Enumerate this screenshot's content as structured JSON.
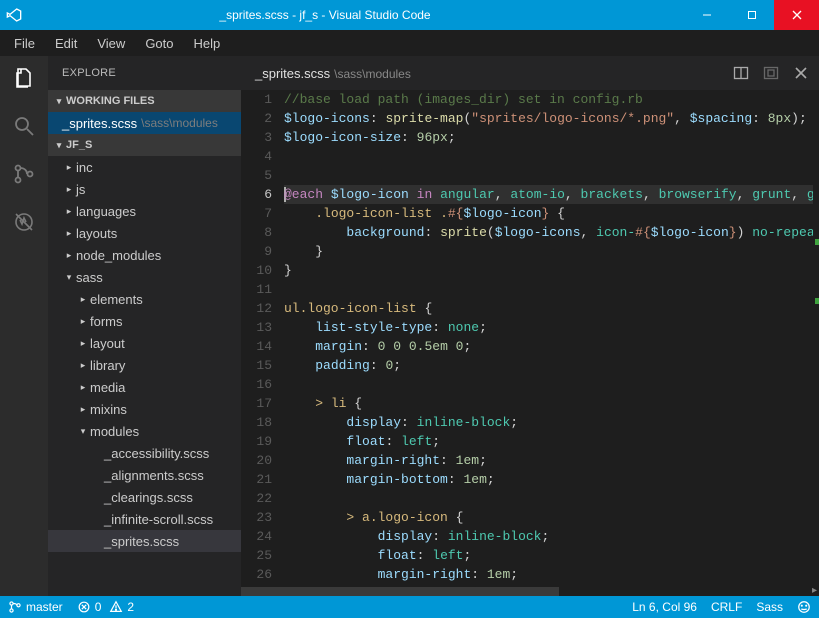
{
  "window": {
    "title": "_sprites.scss - jf_s - Visual Studio Code"
  },
  "menubar": [
    "File",
    "Edit",
    "View",
    "Goto",
    "Help"
  ],
  "sidebar": {
    "title": "EXPLORE",
    "sections": {
      "working": {
        "label": "WORKING FILES",
        "items": [
          {
            "name": "_sprites.scss",
            "path": "\\sass\\modules",
            "selected": true
          }
        ]
      },
      "project": {
        "label": "JF_S",
        "tree": [
          {
            "label": "inc",
            "depth": 1,
            "expandable": true,
            "expanded": false
          },
          {
            "label": "js",
            "depth": 1,
            "expandable": true,
            "expanded": false
          },
          {
            "label": "languages",
            "depth": 1,
            "expandable": true,
            "expanded": false
          },
          {
            "label": "layouts",
            "depth": 1,
            "expandable": true,
            "expanded": false
          },
          {
            "label": "node_modules",
            "depth": 1,
            "expandable": true,
            "expanded": false
          },
          {
            "label": "sass",
            "depth": 1,
            "expandable": true,
            "expanded": true
          },
          {
            "label": "elements",
            "depth": 2,
            "expandable": true,
            "expanded": false
          },
          {
            "label": "forms",
            "depth": 2,
            "expandable": true,
            "expanded": false
          },
          {
            "label": "layout",
            "depth": 2,
            "expandable": true,
            "expanded": false
          },
          {
            "label": "library",
            "depth": 2,
            "expandable": true,
            "expanded": false
          },
          {
            "label": "media",
            "depth": 2,
            "expandable": true,
            "expanded": false
          },
          {
            "label": "mixins",
            "depth": 2,
            "expandable": true,
            "expanded": false
          },
          {
            "label": "modules",
            "depth": 2,
            "expandable": true,
            "expanded": true
          },
          {
            "label": "_accessibility.scss",
            "depth": 3,
            "expandable": false
          },
          {
            "label": "_alignments.scss",
            "depth": 3,
            "expandable": false
          },
          {
            "label": "_clearings.scss",
            "depth": 3,
            "expandable": false
          },
          {
            "label": "_infinite-scroll.scss",
            "depth": 3,
            "expandable": false
          },
          {
            "label": "_sprites.scss",
            "depth": 3,
            "expandable": false,
            "selected": true
          }
        ]
      }
    }
  },
  "tab": {
    "name": "_sprites.scss",
    "path": "\\sass\\modules"
  },
  "code": {
    "first_line": 1,
    "current_line": 6,
    "lines": [
      {
        "n": 1,
        "html": "<span class='c-comm'>//base load path (images_dir) set in config.rb</span>"
      },
      {
        "n": 2,
        "html": "<span class='c-var'>$logo-icons</span><span class='c-punc'>: </span><span class='c-func'>sprite-map</span><span class='c-punc'>(</span><span class='c-str'>\"sprites/logo-icons/*.png\"</span><span class='c-punc'>, </span><span class='c-var'>$spacing</span><span class='c-punc'>: </span><span class='c-num'>8px</span><span class='c-punc'>);</span>"
      },
      {
        "n": 3,
        "html": "<span class='c-var'>$logo-icon-size</span><span class='c-punc'>: </span><span class='c-num'>96px</span><span class='c-punc'>;</span>"
      },
      {
        "n": 4,
        "html": ""
      },
      {
        "n": 5,
        "html": ""
      },
      {
        "n": 6,
        "html": "<span class='cursor-line-cursor'></span><span class='c-kw'>@each</span> <span class='c-var'>$logo-icon</span> <span class='c-kw'>in</span> <span class='c-id'>angular</span><span class='c-punc'>,</span> <span class='c-id'>atom-io</span><span class='c-punc'>,</span> <span class='c-id'>brackets</span><span class='c-punc'>,</span> <span class='c-id'>browserify</span><span class='c-punc'>,</span> <span class='c-id'>grunt</span><span class='c-punc'>,</span> <span class='c-id'>gu</span>",
        "hl": true
      },
      {
        "n": 7,
        "html": "    <span class='c-sel'>.logo-icon-list</span> <span class='c-sel'>.</span><span class='c-interp'>#{</span><span class='c-var'>$logo-icon</span><span class='c-interp'>}</span> <span class='c-punc'>{</span>"
      },
      {
        "n": 8,
        "html": "        <span class='c-prop'>background</span><span class='c-punc'>:</span> <span class='c-func'>sprite</span><span class='c-punc'>(</span><span class='c-var'>$logo-icons</span><span class='c-punc'>,</span> <span class='c-id'>icon-</span><span class='c-interp'>#{</span><span class='c-var'>$logo-icon</span><span class='c-interp'>}</span><span class='c-punc'>)</span> <span class='c-id'>no-repea</span>"
      },
      {
        "n": 9,
        "html": "    <span class='c-punc'>}</span>"
      },
      {
        "n": 10,
        "html": "<span class='c-punc'>}</span>"
      },
      {
        "n": 11,
        "html": ""
      },
      {
        "n": 12,
        "html": "<span class='c-sel'>ul.logo-icon-list</span> <span class='c-punc'>{</span>"
      },
      {
        "n": 13,
        "html": "    <span class='c-prop'>list-style-type</span><span class='c-punc'>:</span> <span class='c-id'>none</span><span class='c-punc'>;</span>"
      },
      {
        "n": 14,
        "html": "    <span class='c-prop'>margin</span><span class='c-punc'>:</span> <span class='c-num'>0 0 0.5em 0</span><span class='c-punc'>;</span>"
      },
      {
        "n": 15,
        "html": "    <span class='c-prop'>padding</span><span class='c-punc'>:</span> <span class='c-num'>0</span><span class='c-punc'>;</span>"
      },
      {
        "n": 16,
        "html": ""
      },
      {
        "n": 17,
        "html": "    <span class='c-sel'>&gt; li</span> <span class='c-punc'>{</span>"
      },
      {
        "n": 18,
        "html": "        <span class='c-prop'>display</span><span class='c-punc'>:</span> <span class='c-id'>inline-block</span><span class='c-punc'>;</span>"
      },
      {
        "n": 19,
        "html": "        <span class='c-prop'>float</span><span class='c-punc'>:</span> <span class='c-id'>left</span><span class='c-punc'>;</span>"
      },
      {
        "n": 20,
        "html": "        <span class='c-prop'>margin-right</span><span class='c-punc'>:</span> <span class='c-num'>1em</span><span class='c-punc'>;</span>"
      },
      {
        "n": 21,
        "html": "        <span class='c-prop'>margin-bottom</span><span class='c-punc'>:</span> <span class='c-num'>1em</span><span class='c-punc'>;</span>"
      },
      {
        "n": 22,
        "html": ""
      },
      {
        "n": 23,
        "html": "        <span class='c-sel'>&gt; a.logo-icon</span> <span class='c-punc'>{</span>"
      },
      {
        "n": 24,
        "html": "            <span class='c-prop'>display</span><span class='c-punc'>:</span> <span class='c-id'>inline-block</span><span class='c-punc'>;</span>"
      },
      {
        "n": 25,
        "html": "            <span class='c-prop'>float</span><span class='c-punc'>:</span> <span class='c-id'>left</span><span class='c-punc'>;</span>"
      },
      {
        "n": 26,
        "html": "            <span class='c-prop'>margin-right</span><span class='c-punc'>:</span> <span class='c-num'>1em</span><span class='c-punc'>;</span>"
      }
    ]
  },
  "status": {
    "branch": "master",
    "errors": "0",
    "warnings": "2",
    "cursor": "Ln 6, Col 96",
    "eol": "CRLF",
    "lang": "Sass"
  }
}
